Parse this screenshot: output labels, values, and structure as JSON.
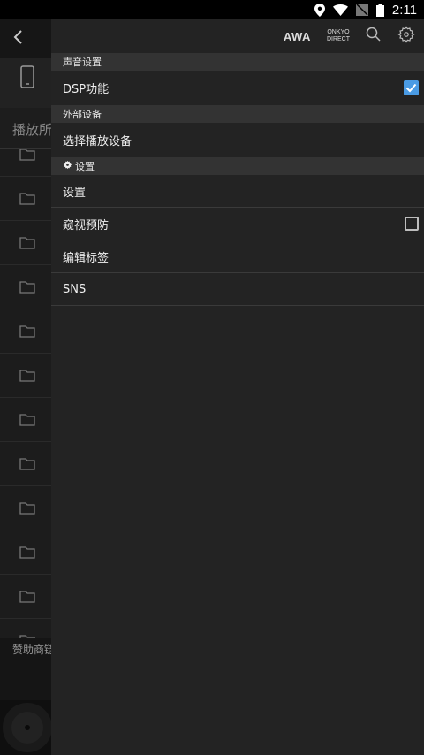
{
  "status_bar": {
    "time": "2:11",
    "icons": [
      "location-icon",
      "wifi-icon",
      "signal-off-icon",
      "battery-icon"
    ]
  },
  "background": {
    "tab_label": "播放所",
    "sponsor_label": "赞助商链",
    "back_icon": "back-icon",
    "device_icon": "phone-icon",
    "folder_count": 12
  },
  "drawer": {
    "header": {
      "awa_label": "AWA",
      "onkyo_line1": "ONKYO",
      "onkyo_line2": "DIRECT",
      "search_icon": "search-icon",
      "settings_icon": "gear-icon"
    },
    "sections": {
      "sound": {
        "title": "声音设置",
        "dsp_label": "DSP功能",
        "dsp_checked": true
      },
      "external": {
        "title": "外部设备",
        "select_device_label": "选择播放设备"
      },
      "settings": {
        "title": "设置",
        "settings_label": "设置",
        "peek_prevention_label": "窥视预防",
        "peek_prevention_checked": false,
        "edit_tags_label": "编辑标签",
        "sns_label": "SNS"
      }
    }
  },
  "colors": {
    "accent": "#4a9be4",
    "drawer_bg": "#232323",
    "section_bg": "#333333"
  }
}
